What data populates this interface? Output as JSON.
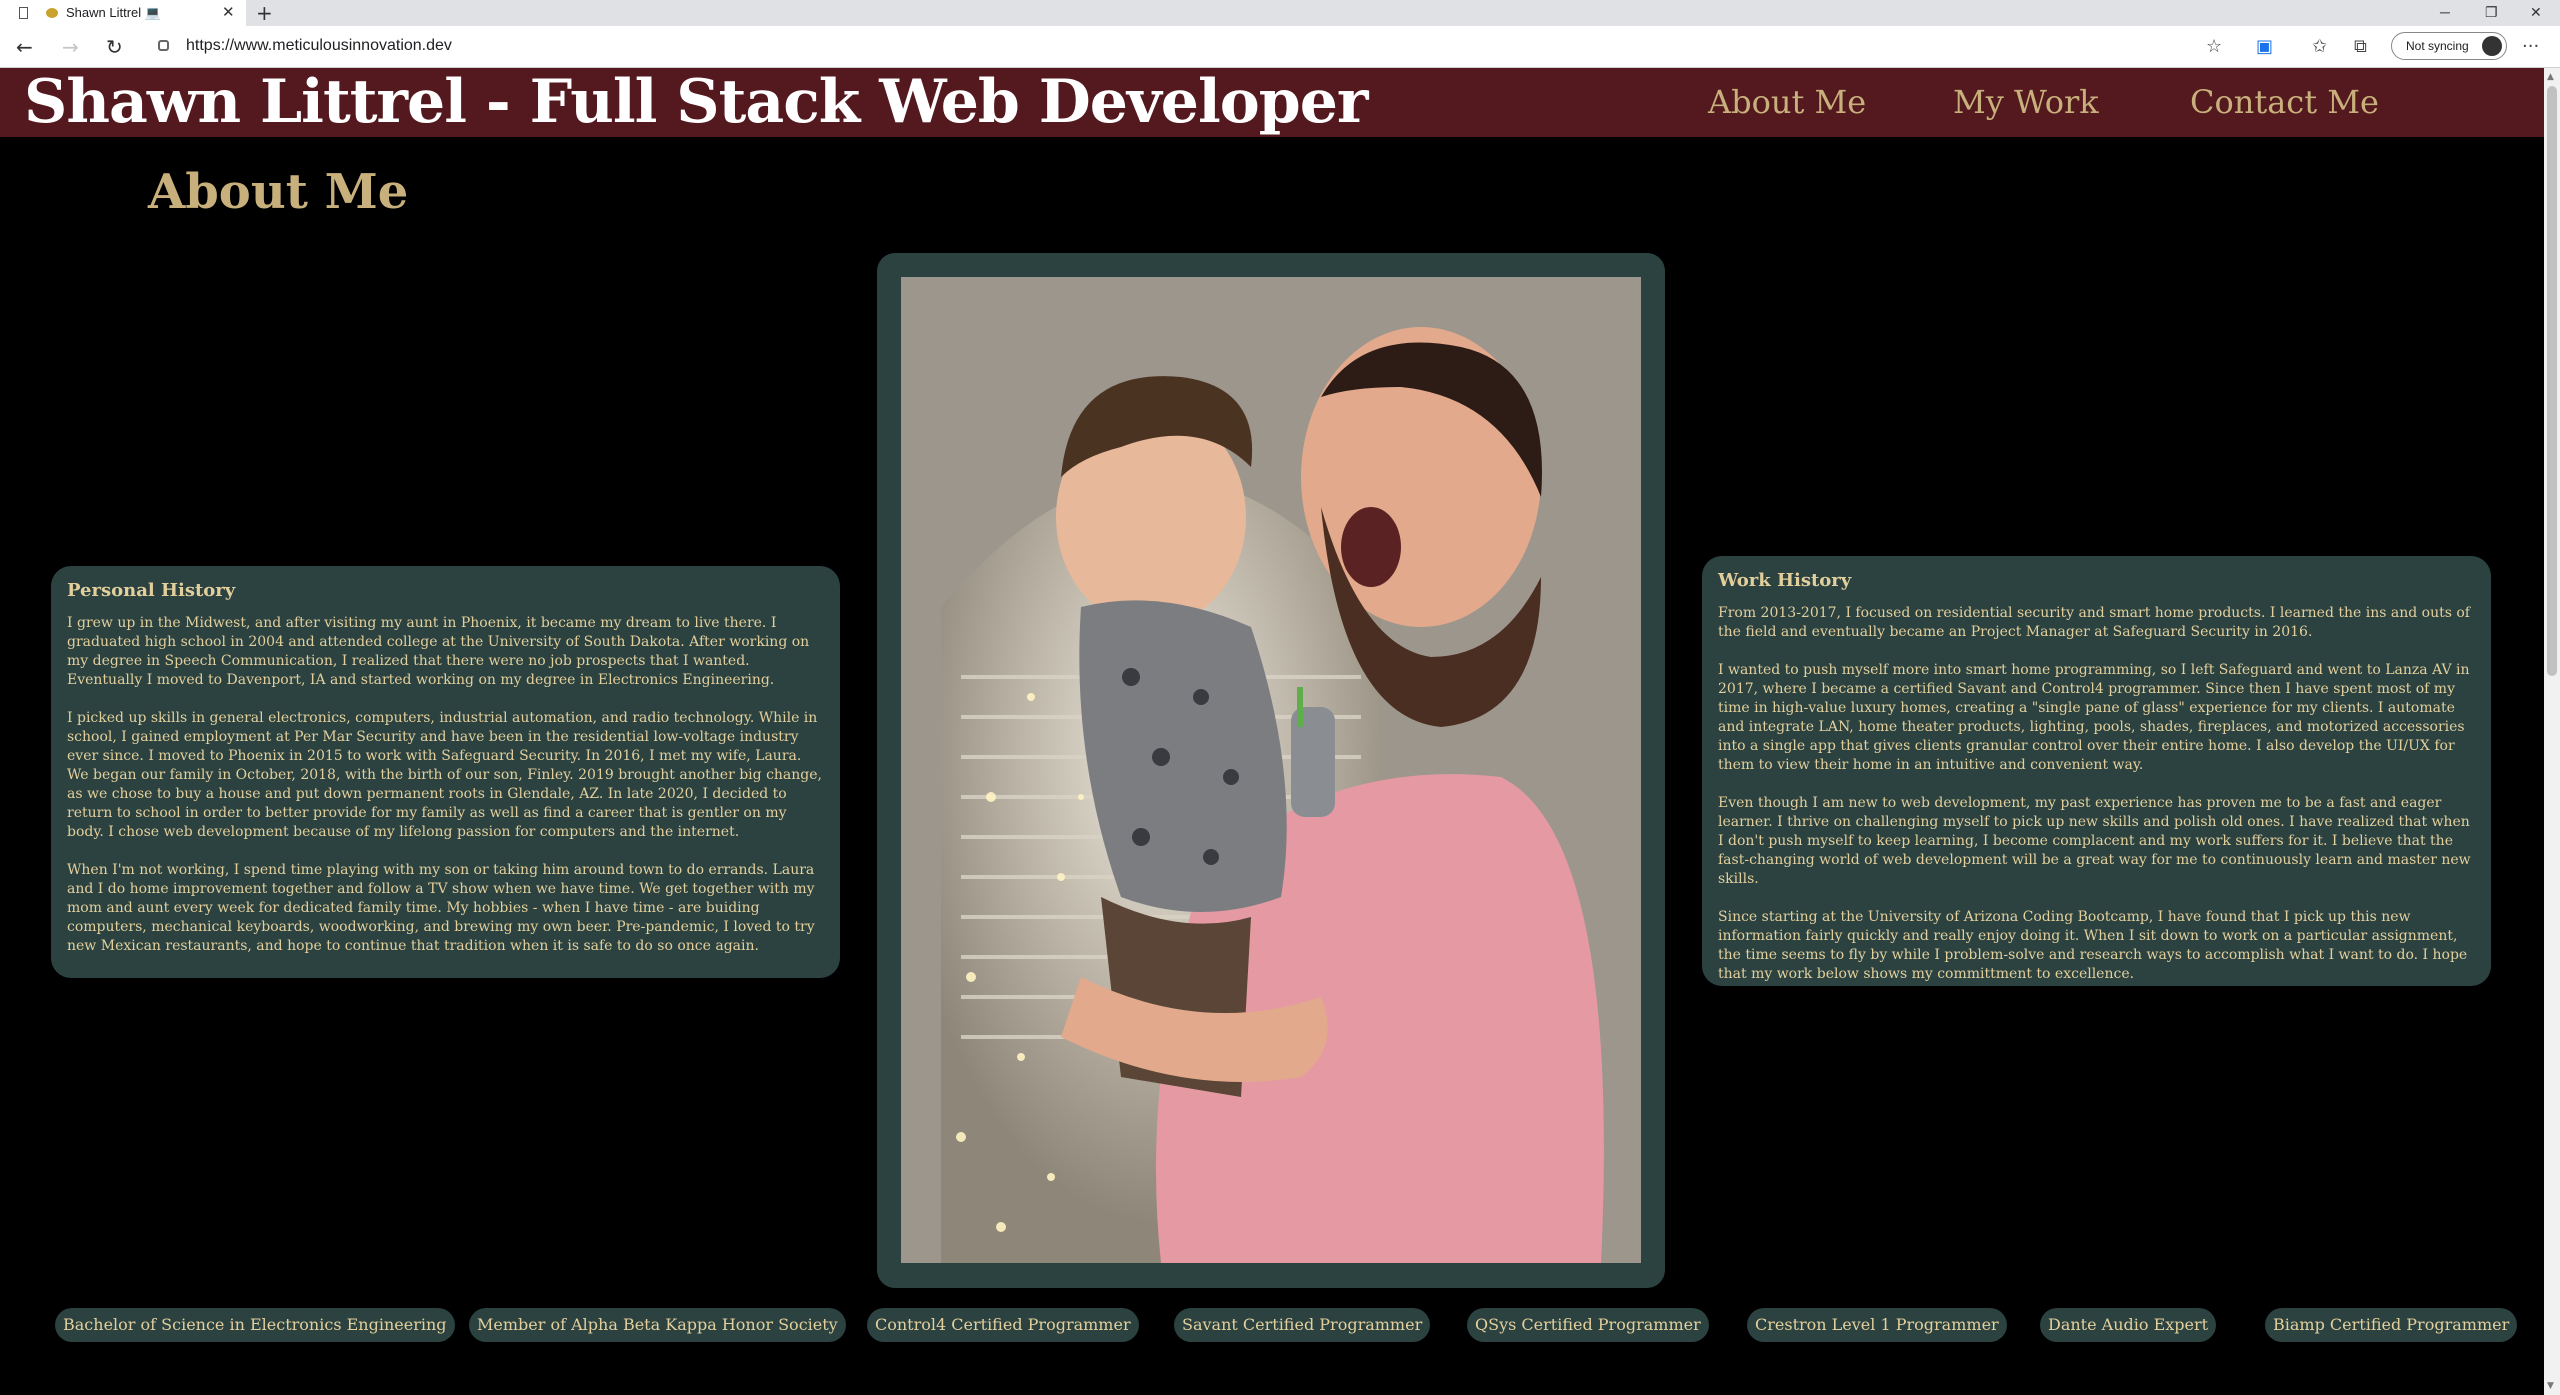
{
  "browser": {
    "tab_title": "Shawn Littrel 💻",
    "tab_close": "✕",
    "new_tab": "+",
    "url": "https://www.meticulousinnovation.dev",
    "back": "←",
    "forward": "→",
    "refresh": "↻",
    "sync_label": "Not syncing",
    "window_minimize": "─",
    "window_restore": "❐",
    "window_close": "✕",
    "more": "···",
    "favorite": "☆",
    "favorites": "✩",
    "collections": "⧉"
  },
  "site": {
    "title": "Shawn Littrel - Full Stack Web Developer",
    "nav": [
      "About Me",
      "My Work",
      "Contact Me"
    ],
    "section_heading": "About Me"
  },
  "personal_history": {
    "heading": "Personal History",
    "paragraphs": [
      "I grew up in the Midwest, and after visiting my aunt in Phoenix, it became my dream to live there. I graduated high school in 2004 and attended college at the University of South Dakota. After working on my degree in Speech Communication, I realized that there were no job prospects that I wanted. Eventually I moved to Davenport, IA and started working on my degree in Electronics Engineering.",
      "I picked up skills in general electronics, computers, industrial automation, and radio technology. While in school, I gained employment at Per Mar Security and have been in the residential low-voltage industry ever since. I moved to Phoenix in 2015 to work with Safeguard Security. In 2016, I met my wife, Laura. We began our family in October, 2018, with the birth of our son, Finley. 2019 brought another big change, as we chose to buy a house and put down permanent roots in Glendale, AZ. In late 2020, I decided to return to school in order to better provide for my family as well as find a career that is gentler on my body. I chose web development because of my lifelong passion for computers and the internet.",
      "When I'm not working, I spend time playing with my son or taking him around town to do errands. Laura and I do home improvement together and follow a TV show when we have time. We get together with my mom and aunt every week for dedicated family time. My hobbies - when I have time - are buiding computers, mechanical keyboards, woodworking, and brewing my own beer. Pre-pandemic, I loved to try new Mexican restaurants, and hope to continue that tradition when it is safe to do so once again."
    ]
  },
  "work_history": {
    "heading": "Work History",
    "paragraphs": [
      "From 2013-2017, I focused on residential security and smart home products. I learned the ins and outs of the field and eventually became an Project Manager at Safeguard Security in 2016.",
      "I wanted to push myself more into smart home programming, so I left Safeguard and went to Lanza AV in 2017, where I became a certified Savant and Control4 programmer. Since then I have spent most of my time in high-value luxury homes, creating a \"single pane of glass\" experience for my clients. I automate and integrate LAN, home theater products, lighting, pools, shades, fireplaces, and motorized accessories into a single app that gives clients granular control over their entire home. I also develop the UI/UX for them to view their home in an intuitive and convenient way.",
      "Even though I am new to web development, my past experience has proven me to be a fast and eager learner. I thrive on challenging myself to pick up new skills and polish old ones. I have realized that when I don't push myself to keep learning, I become complacent and my work suffers for it. I believe that the fast-changing world of web development will be a great way for me to continuously learn and master new skills.",
      "Since starting at the University of Arizona Coding Bootcamp, I have found that I pick up this new information fairly quickly and really enjoy doing it. When I sit down to work on a particular assignment, the time seems to fly by while I problem-solve and research ways to accomplish what I want to do. I hope that my work below shows my committment to excellence."
    ]
  },
  "badges": [
    "Bachelor of Science in Electronics Engineering",
    "Member of Alpha Beta Kappa Honor Society",
    "Control4 Certified Programmer",
    "Savant Certified Programmer",
    "QSys Certified Programmer",
    "Crestron Level 1 Programmer",
    "Dante Audio Expert",
    "Biamp Certified Programmer"
  ],
  "colors": {
    "header_bg": "#54191f",
    "accent_gold": "#c8b07c",
    "card_bg": "#2b4240",
    "page_bg": "#000000"
  }
}
